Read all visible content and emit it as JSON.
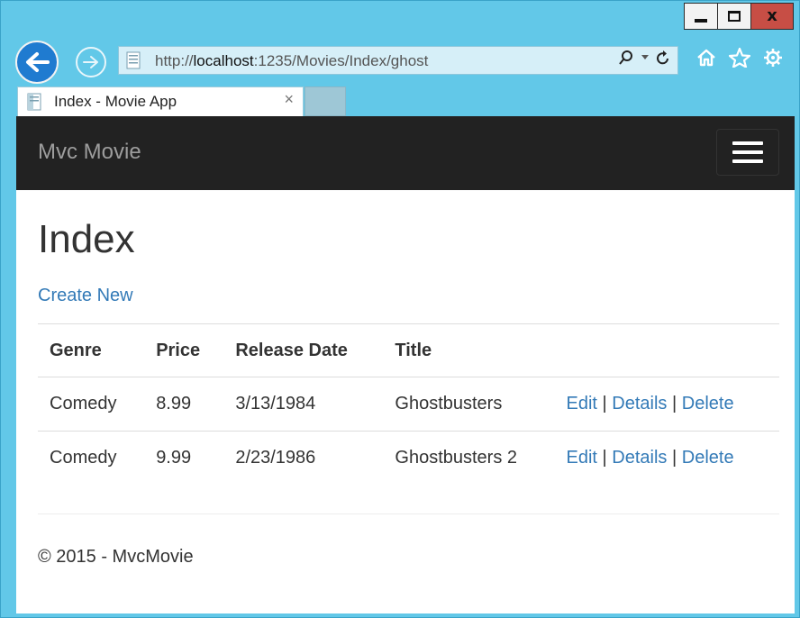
{
  "browser": {
    "url_prefix": "http://",
    "url_host": "localhost",
    "url_rest": ":1235/Movies/Index/ghost",
    "tab_title": "Index - Movie App",
    "tab_close": "×",
    "caption_close": "x"
  },
  "navbar": {
    "brand": "Mvc Movie"
  },
  "main": {
    "heading": "Index",
    "create_link": "Create New",
    "columns": [
      "Genre",
      "Price",
      "Release Date",
      "Title"
    ],
    "rows": [
      {
        "genre": "Comedy",
        "price": "8.99",
        "release_date": "3/13/1984",
        "title": "Ghostbusters"
      },
      {
        "genre": "Comedy",
        "price": "9.99",
        "release_date": "2/23/1986",
        "title": "Ghostbusters 2"
      }
    ],
    "actions": {
      "edit": "Edit",
      "details": "Details",
      "delete": "Delete",
      "separator": "|"
    }
  },
  "footer": {
    "text": "© 2015 - MvcMovie"
  },
  "icons": {
    "back": "back-arrow-icon",
    "forward": "forward-arrow-icon",
    "search": "search-icon",
    "refresh": "refresh-icon",
    "home": "home-icon",
    "favorites": "star-icon",
    "settings": "gear-icon"
  }
}
